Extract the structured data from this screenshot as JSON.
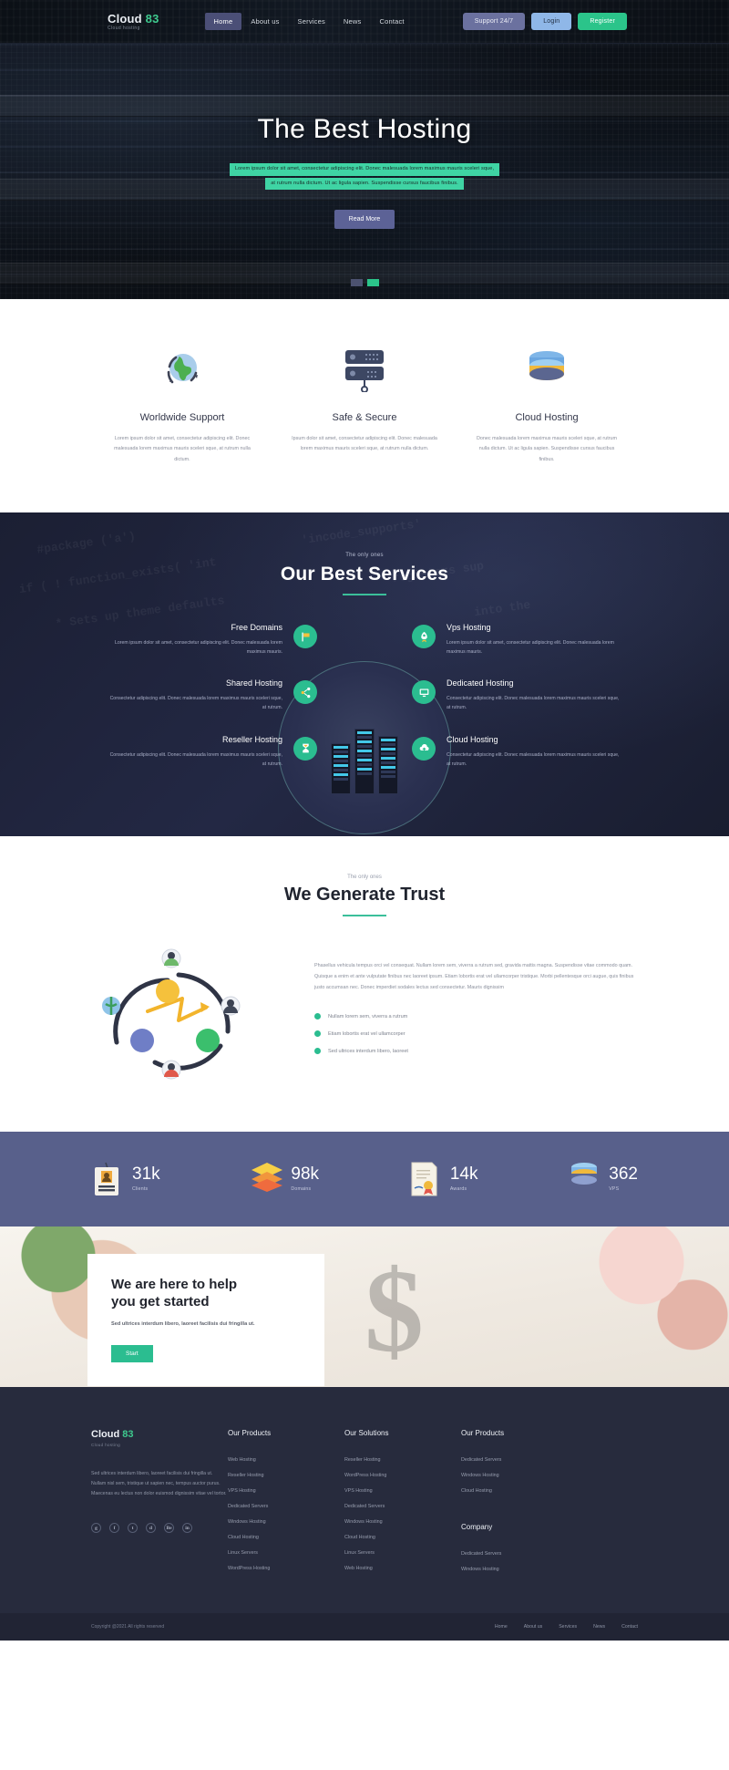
{
  "header": {
    "brand": {
      "name_main": "Cloud",
      "name_accent": "83",
      "tagline": "Cloud hosting"
    },
    "nav": [
      {
        "label": "Home",
        "active": true
      },
      {
        "label": "About us",
        "active": false
      },
      {
        "label": "Services",
        "active": false
      },
      {
        "label": "News",
        "active": false
      },
      {
        "label": "Contact",
        "active": false
      }
    ],
    "actions": {
      "support": "Support 24/7",
      "login": "Login",
      "register": "Register"
    }
  },
  "hero": {
    "title": "The Best Hosting",
    "paragraph_line1": "Lorem ipsum dolor sit amet, consectetur adipiscing elit. Donec malesuada lorem maximus mauris sceleri sque,",
    "paragraph_line2": "at rutrum nulla dictum. Ut ac ligula sapien. Suspendisse cursus faucibus finibus.",
    "button": "Read More",
    "slides": [
      {
        "active": false
      },
      {
        "active": true
      }
    ]
  },
  "features": [
    {
      "icon": "globe-icon",
      "title": "Worldwide Support",
      "desc": "Lorem ipsum dolor sit amet, consectetur adipiscing elit. Donec malesuada lorem maximus mauris sceleri sque, at rutrum nulla dictum."
    },
    {
      "icon": "server-icon",
      "title": "Safe & Secure",
      "desc": "Ipsum dolor sit amet, consectetur adipiscing elit. Donec malesuada lorem maximus mauris sceleri sque, at rutrum nulla dictum."
    },
    {
      "icon": "database-icon",
      "title": "Cloud Hosting",
      "desc": "Donec malesuada lorem maximus mauris sceleri sque, at rutrum nulla dictum. Ut ac ligula sapien. Suspendisse cursus faucibus finibus."
    }
  ],
  "services": {
    "eyebrow": "The only ones",
    "title": "Our Best Services",
    "items": [
      {
        "name": "Free Domains",
        "desc": "Lorem ipsum dolor sit amet, consectetur adipiscing elit. Donec malesuada lorem maximus mauris.",
        "icon": "flag-icon",
        "side": "left"
      },
      {
        "name": "Vps Hosting",
        "desc": "Lorem ipsum dolor sit amet, consectetur adipiscing elit. Donec malesuada lorem maximus mauris.",
        "icon": "rocket-icon",
        "side": "right"
      },
      {
        "name": "Shared Hosting",
        "desc": "Consectetur adipiscing elit. Donec malesuada lorem maximus mauris sceleri sque, at rutrum.",
        "icon": "share-icon",
        "side": "left"
      },
      {
        "name": "Dedicated Hosting",
        "desc": "Consectetur adipiscing elit. Donec malesuada lorem maximus mauris sceleri sque, at rutrum.",
        "icon": "monitor-icon",
        "side": "right"
      },
      {
        "name": "Reseller Hosting",
        "desc": "Consectetur adipiscing elit. Donec malesuada lorem maximus mauris sceleri sque, at rutrum.",
        "icon": "hourglass-icon",
        "side": "left"
      },
      {
        "name": "Cloud Hosting",
        "desc": "Consectetur adipiscing elit. Donec malesuada lorem maximus mauris sceleri sque, at rutrum.",
        "icon": "cloud-upload-icon",
        "side": "right"
      }
    ]
  },
  "trust": {
    "eyebrow": "The only ones",
    "title": "We Generate Trust",
    "paragraph": "Phasellus vehicula tempus orci vel consequat. Nullam lorem sem, viverra a rutrum sed, gravida mattis magna. Suspendisse vitae commodo quam. Quisque a enim et ante vulputate finibus nec laoreet ipsum. Etiam lobortis erat vel ullamcorper tristique. Morbi pellentesque orci augue, quis finibus justo accumsan nec. Donec imperdiet sodales lectus sed consectetur. Mauris dignissim",
    "bullets": [
      "Nullam lorem sem, viverra a rutrum",
      "Etiam lobortis erat vel ullamcorper",
      "Sed ultrices interdum libero, laoreet"
    ]
  },
  "stats": [
    {
      "icon": "id-card-icon",
      "value": "31k",
      "label": "Clients"
    },
    {
      "icon": "layers-icon",
      "value": "98k",
      "label": "Domains"
    },
    {
      "icon": "certificate-icon",
      "value": "14k",
      "label": "Awards"
    },
    {
      "icon": "database-stack-icon",
      "value": "362",
      "label": "VPS"
    }
  ],
  "cta": {
    "title_line1": "We are here to help",
    "title_line2": "you get started",
    "subtitle": "Sed ultrices interdum libero, laoreet facilisis dui fringilla ut.",
    "button": "Start",
    "background_glyph": "$"
  },
  "footer": {
    "brand": {
      "name_main": "Cloud",
      "name_accent": "83",
      "tagline": "Cloud hosting"
    },
    "about": "Sed ultrices interdum libero, laoreet facilisis dui fringilla ut. Nullam nisl sem, tristique ut sapien nec, tempus auctor purus. Maecenas eu lectus non dolor euismod dignissim vitae vel tortor.",
    "social": [
      {
        "icon": "google-plus-icon",
        "glyph": "g"
      },
      {
        "icon": "facebook-icon",
        "glyph": "f"
      },
      {
        "icon": "twitter-icon",
        "glyph": "t"
      },
      {
        "icon": "dribbble-icon",
        "glyph": "d"
      },
      {
        "icon": "behance-icon",
        "glyph": "Be"
      },
      {
        "icon": "linkedin-icon",
        "glyph": "in"
      }
    ],
    "columns": [
      {
        "heading": "Our Products",
        "links": [
          "Web Hosting",
          "Reseller Hosting",
          "VPS Hosting",
          "Dedicated Servers",
          "Windows Hosting",
          "Cloud Hosting",
          "Linux Servers",
          "WordPress Hosting"
        ]
      },
      {
        "heading": "Our Solutions",
        "links": [
          "Reseller Hosting",
          "WordPress Hosting",
          "VPS Hosting",
          "Dedicated Servers",
          "Windows Hosting",
          "Cloud Hosting",
          "Linux Servers",
          "Web Hosting"
        ]
      },
      {
        "heading": "Our Products",
        "links": [
          "Dedicated Servers",
          "Windows Hosting",
          "Cloud Hosting"
        ],
        "heading2": "Company",
        "links2": [
          "Dedicated Servers",
          "Windows Hosting"
        ]
      }
    ],
    "bottom": {
      "copyright": "Copyright @2021 All rights reserved",
      "nav": [
        "Home",
        "About us",
        "Services",
        "News",
        "Contact"
      ]
    }
  },
  "colors": {
    "accent_green": "#2bbd90",
    "hero_highlight": "#3fd4a4",
    "purple_button": "#6b719f",
    "login_blue": "#8fb7e8",
    "stats_bg": "#58608b",
    "footer_bg": "#272b3d",
    "services_bg": "#1d2136"
  }
}
